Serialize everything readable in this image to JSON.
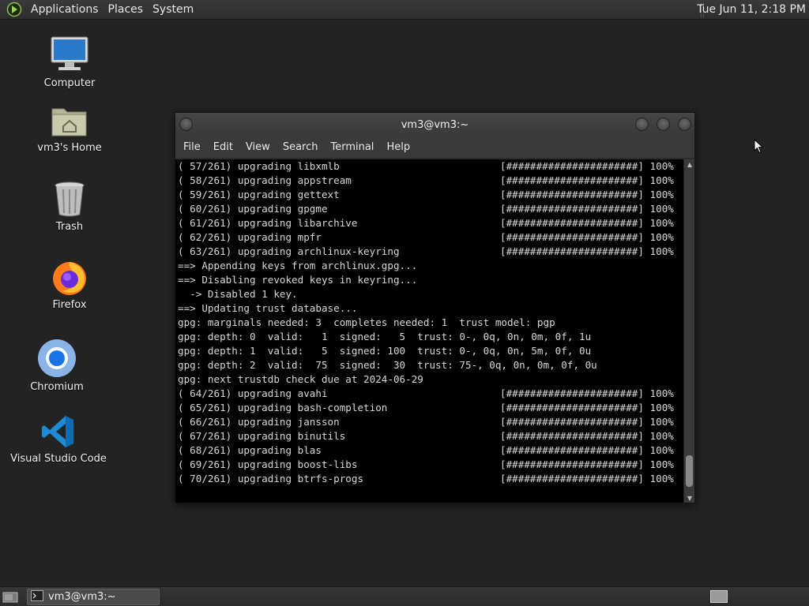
{
  "top_panel": {
    "menus": [
      "Applications",
      "Places",
      "System"
    ],
    "clock": "Tue Jun 11,  2:18 PM"
  },
  "desktop": {
    "icons": [
      {
        "label": "Computer",
        "icon": "computer-icon"
      },
      {
        "label": "vm3's Home",
        "icon": "home-folder-icon"
      },
      {
        "label": "Trash",
        "icon": "trash-icon"
      },
      {
        "label": "Firefox",
        "icon": "firefox-icon"
      },
      {
        "label": "Chromium",
        "icon": "chromium-icon"
      },
      {
        "label": "Visual Studio Code",
        "icon": "vscode-icon"
      }
    ]
  },
  "terminal": {
    "title": "vm3@vm3:~",
    "menu": [
      "File",
      "Edit",
      "View",
      "Search",
      "Terminal",
      "Help"
    ],
    "lines": [
      {
        "text": "( 57/261) upgrading libxmlb",
        "status": "[######################] 100%"
      },
      {
        "text": "( 58/261) upgrading appstream",
        "status": "[######################] 100%"
      },
      {
        "text": "( 59/261) upgrading gettext",
        "status": "[######################] 100%"
      },
      {
        "text": "( 60/261) upgrading gpgme",
        "status": "[######################] 100%"
      },
      {
        "text": "( 61/261) upgrading libarchive",
        "status": "[######################] 100%"
      },
      {
        "text": "( 62/261) upgrading mpfr",
        "status": "[######################] 100%"
      },
      {
        "text": "( 63/261) upgrading archlinux-keyring",
        "status": "[######################] 100%"
      },
      {
        "text": "==> Appending keys from archlinux.gpg...",
        "status": ""
      },
      {
        "text": "==> Disabling revoked keys in keyring...",
        "status": ""
      },
      {
        "text": "  -> Disabled 1 key.",
        "status": ""
      },
      {
        "text": "==> Updating trust database...",
        "status": ""
      },
      {
        "text": "gpg: marginals needed: 3  completes needed: 1  trust model: pgp",
        "status": ""
      },
      {
        "text": "gpg: depth: 0  valid:   1  signed:   5  trust: 0-, 0q, 0n, 0m, 0f, 1u",
        "status": ""
      },
      {
        "text": "gpg: depth: 1  valid:   5  signed: 100  trust: 0-, 0q, 0n, 5m, 0f, 0u",
        "status": ""
      },
      {
        "text": "gpg: depth: 2  valid:  75  signed:  30  trust: 75-, 0q, 0n, 0m, 0f, 0u",
        "status": ""
      },
      {
        "text": "gpg: next trustdb check due at 2024-06-29",
        "status": ""
      },
      {
        "text": "( 64/261) upgrading avahi",
        "status": "[######################] 100%"
      },
      {
        "text": "( 65/261) upgrading bash-completion",
        "status": "[######################] 100%"
      },
      {
        "text": "( 66/261) upgrading jansson",
        "status": "[######################] 100%"
      },
      {
        "text": "( 67/261) upgrading binutils",
        "status": "[######################] 100%"
      },
      {
        "text": "( 68/261) upgrading blas",
        "status": "[######################] 100%"
      },
      {
        "text": "( 69/261) upgrading boost-libs",
        "status": "[######################] 100%"
      },
      {
        "text": "( 70/261) upgrading btrfs-progs",
        "status": "[######################] 100%"
      }
    ]
  },
  "taskbar": {
    "task_label": "vm3@vm3:~"
  },
  "colors": {
    "desktop_bg": "#232323",
    "terminal_bg": "#000000",
    "terminal_fg": "#d8d8d8"
  }
}
